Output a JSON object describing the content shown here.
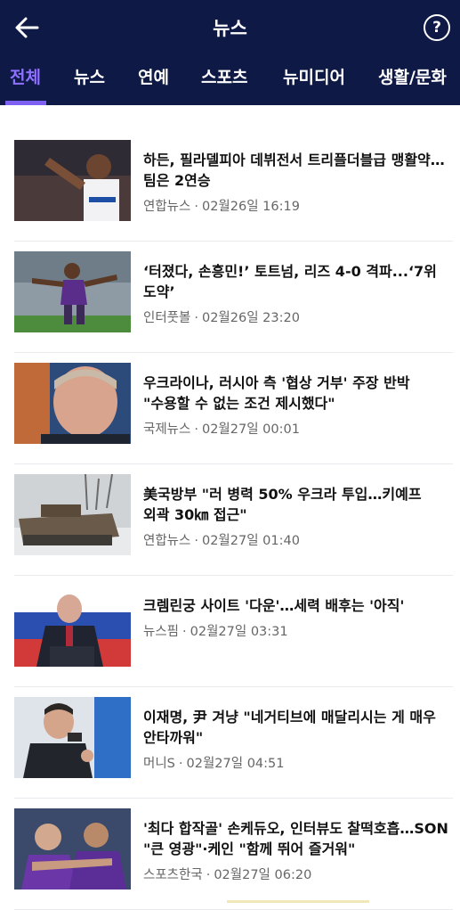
{
  "header": {
    "title": "뉴스"
  },
  "tabs": [
    {
      "label": "전체",
      "active": true
    },
    {
      "label": "뉴스"
    },
    {
      "label": "연예"
    },
    {
      "label": "스포츠"
    },
    {
      "label": "뉴미디어"
    },
    {
      "label": "생활/문화"
    }
  ],
  "articles": [
    {
      "headline": "하든, 필라델피아 데뷔전서 트리플더블급 맹활약…팀은 2연승",
      "source": "연합뉴스",
      "datetime": "02월26일 16:19",
      "thumb": "basketball-player-photo"
    },
    {
      "headline": "‘터졌다, 손흥민!’ 토트넘, 리즈 4-0 격파...‘7위 도약’",
      "source": "인터풋볼",
      "datetime": "02월26일 23:20",
      "thumb": "soccer-player-photo"
    },
    {
      "headline": "우크라이나, 러시아 측 '협상 거부' 주장 반박 \"수용할 수 없는 조건 제시했다\"",
      "source": "국제뉴스",
      "datetime": "02월27일 00:01",
      "thumb": "putin-portrait-photo"
    },
    {
      "headline": "美국방부 \"러 병력 50% 우크라 투입…키예프 외곽 30㎞ 접근\"",
      "source": "연합뉴스",
      "datetime": "02월27일 01:40",
      "thumb": "destroyed-tank-photo"
    },
    {
      "headline": "크렘린궁 사이트 '다운'…세력 배후는 '아직'",
      "source": "뉴스핌",
      "datetime": "02월27일 03:31",
      "thumb": "putin-podium-photo"
    },
    {
      "headline": "이재명, 尹 겨냥 \"네거티브에 매달리시는 게 매우 안타까워\"",
      "source": "머니S",
      "datetime": "02월27일 04:51",
      "thumb": "politician-speech-photo"
    },
    {
      "headline": "'최다 합작골' 손케듀오, 인터뷰도 찰떡호흡…SON \"큰 영광\"·케인 \"함께 뛰어 즐거워\"",
      "source": "스포츠한국",
      "datetime": "02월27일 06:20",
      "thumb": "soccer-duo-photo"
    }
  ],
  "colors": {
    "header_bg": "#0e1a45",
    "active_tab": "#8f71ff"
  },
  "icons": {
    "back": "arrow-left-icon",
    "help": "question-circle-icon"
  },
  "help_glyph": "?"
}
